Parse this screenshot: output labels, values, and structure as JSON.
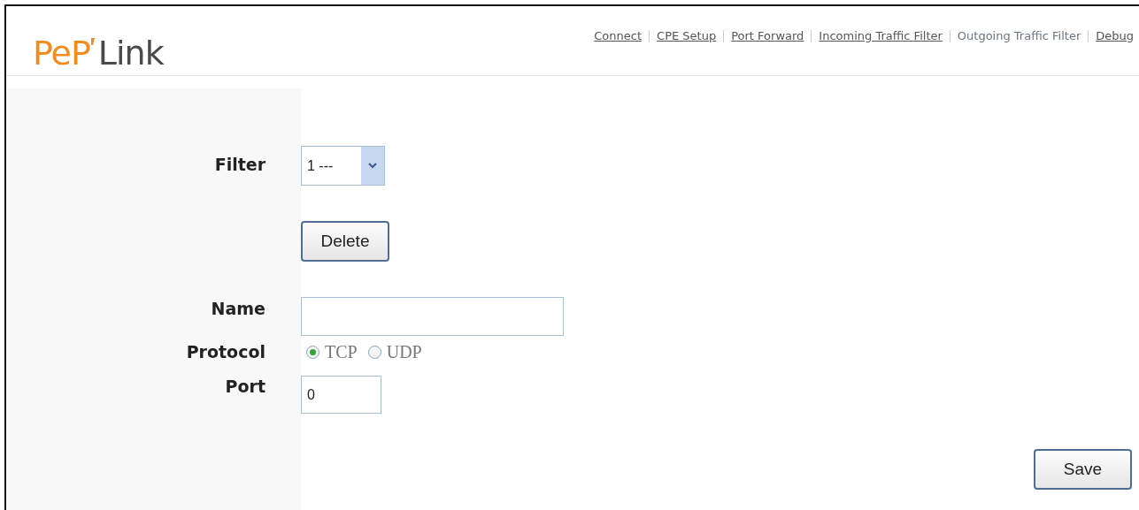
{
  "logo": {
    "brand": "PeP",
    "product": "Link"
  },
  "nav": [
    {
      "label": "Connect",
      "selected": false
    },
    {
      "label": "CPE Setup",
      "selected": false
    },
    {
      "label": "Port Forward",
      "selected": false
    },
    {
      "label": "Incoming Traffic Filter",
      "selected": false
    },
    {
      "label": "Outgoing Traffic Filter",
      "selected": true
    },
    {
      "label": "Debug",
      "selected": false
    }
  ],
  "form": {
    "filter": {
      "label": "Filter",
      "value": "1 ---"
    },
    "delete_button": "Delete",
    "name": {
      "label": "Name"
    },
    "protocol": {
      "label": "Protocol",
      "options": [
        {
          "label": "TCP",
          "selected": true
        },
        {
          "label": "UDP",
          "selected": false
        }
      ]
    },
    "port": {
      "label": "Port",
      "value": "0"
    },
    "save_button": "Save"
  }
}
